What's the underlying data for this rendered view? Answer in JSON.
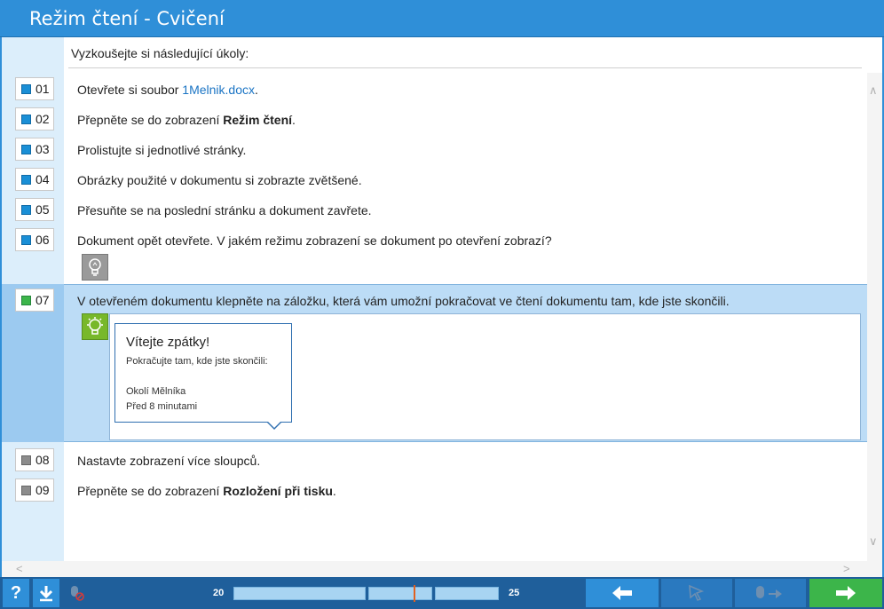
{
  "window": {
    "title": "Režim čtení - Cvičení"
  },
  "intro": "Vyzkoušejte si následující úkoly:",
  "tasks": [
    {
      "num": "01",
      "status": "blue",
      "text_before": "Otevřete si soubor ",
      "link": "1Melnik.docx",
      "text_after": "."
    },
    {
      "num": "02",
      "status": "blue",
      "text_before": "Přepněte se do zobrazení ",
      "bold": "Režim čtení",
      "text_after": "."
    },
    {
      "num": "03",
      "status": "blue",
      "text": "Prolistujte si jednotlivé stránky."
    },
    {
      "num": "04",
      "status": "blue",
      "text": "Obrázky použité v dokumentu si zobrazte zvětšené."
    },
    {
      "num": "05",
      "status": "blue",
      "text": "Přesuňte se na poslední stránku a dokument zavřete."
    },
    {
      "num": "06",
      "status": "blue",
      "text": "Dokument opět otevřete. V jakém režimu zobrazení se dokument po otevření zobrazí?"
    },
    {
      "num": "07",
      "status": "green",
      "text": "V otevřeném dokumentu klepněte na záložku, která vám umožní pokračovat ve čtení dokumentu tam, kde jste skončili."
    },
    {
      "num": "08",
      "status": "gray",
      "text": "Nastavte zobrazení více sloupců."
    },
    {
      "num": "09",
      "status": "gray",
      "text_before": "Přepněte se do zobrazení ",
      "bold": "Rozložení při tisku",
      "text_after": "."
    }
  ],
  "popup": {
    "title": "Vítejte zpátky!",
    "subtitle": "Pokračujte tam, kde jste skončili:",
    "location": "Okolí Mělníka",
    "time": "Před 8 minutami"
  },
  "progress": {
    "start": "20",
    "end": "25",
    "position_fraction": 0.68
  },
  "bottom": {
    "help_label": "?"
  },
  "colors": {
    "accent": "#2f8fd8",
    "active_row": "#bcdcf6",
    "next": "#3cb54a",
    "bar": "#1f5f9b"
  },
  "icons": [
    "help-icon",
    "download-icon",
    "mouse-disabled-icon",
    "lightbulb-icon",
    "arrow-left-icon",
    "pointer-icon",
    "mouse-arrow-icon",
    "arrow-right-icon"
  ]
}
